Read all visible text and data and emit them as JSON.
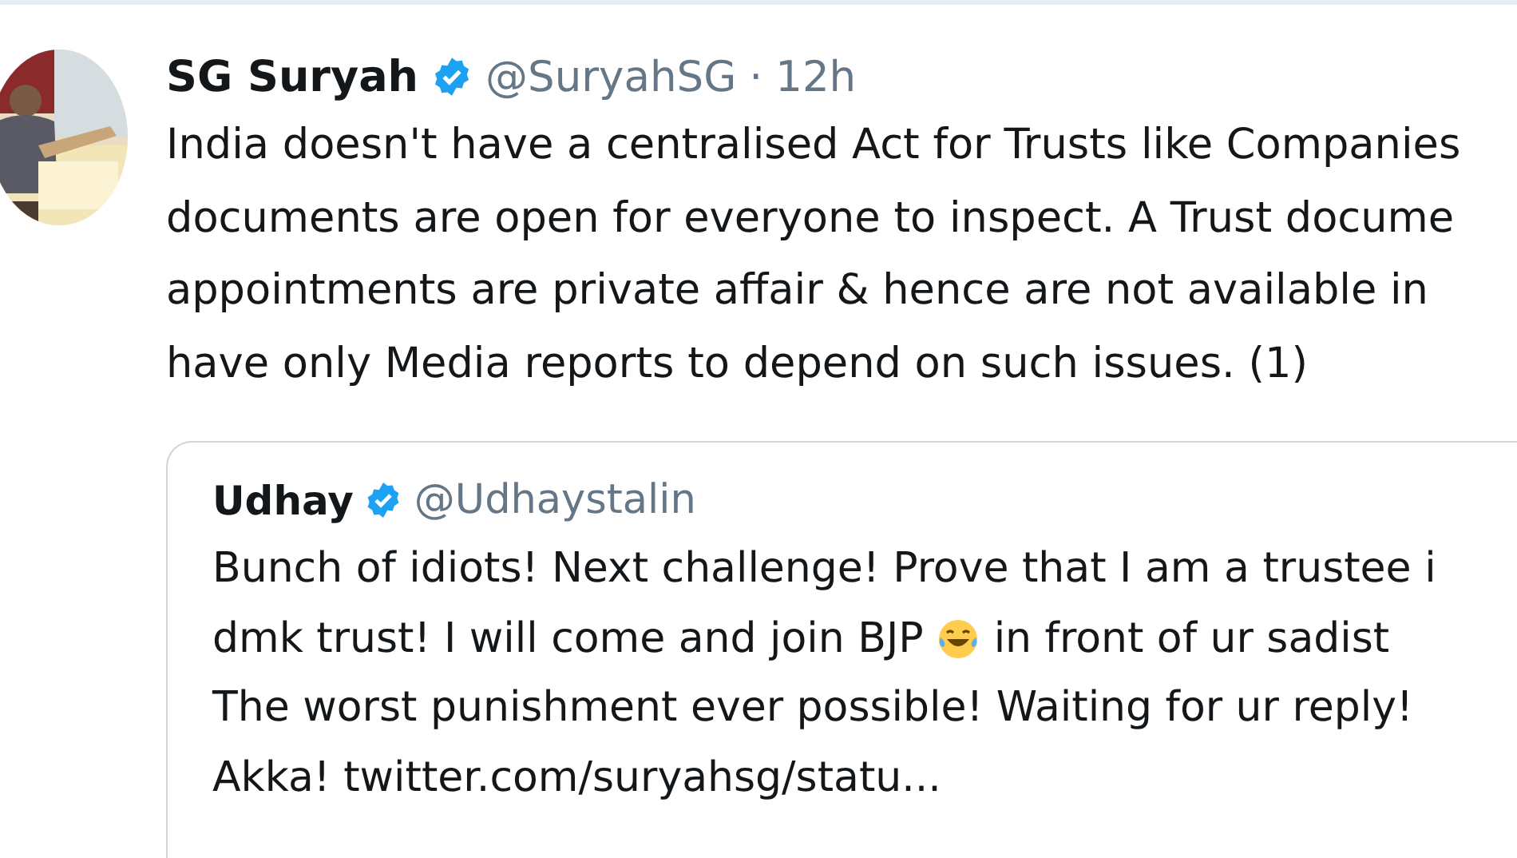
{
  "tweet": {
    "name": "SG Suryah",
    "verified": true,
    "handle": "@SuryahSG",
    "separator": "·",
    "time": "12h",
    "text_lines": [
      "India doesn't have a centralised Act for Trusts like Companies",
      "documents are open for everyone to inspect. A Trust docume",
      "appointments are private affair & hence are not available in",
      "have only Media reports to depend on such issues. (1)"
    ],
    "quoted": {
      "name": "Udhay",
      "verified": true,
      "handle": "@Udhaystalin",
      "text_lines": [
        [
          "Bunch of idiots! Next challenge! Prove that I am a trustee i"
        ],
        [
          "dmk trust! I will come and join BJP",
          {
            "kind": "emoji"
          },
          "in front of ur sadist"
        ],
        [
          "The worst punishment ever possible! Waiting for ur reply!"
        ],
        [
          "Akka! twitter.com/suryahsg/statu..."
        ]
      ]
    }
  }
}
